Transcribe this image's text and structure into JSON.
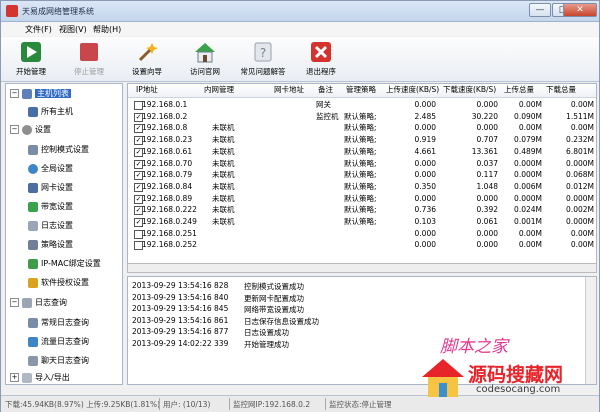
{
  "window": {
    "title": "天易成网络管理系统",
    "min": "—",
    "max": "□",
    "close": "✕"
  },
  "menu": [
    {
      "label": "文件(F)"
    },
    {
      "label": "视图(V)"
    },
    {
      "label": "帮助(H)"
    }
  ],
  "toolbar": [
    {
      "label": "开始管理",
      "icon": "play-icon",
      "color": "#2a8a3c",
      "enabled": true
    },
    {
      "label": "停止管理",
      "icon": "stop-icon",
      "color": "#c9474a",
      "enabled": false
    },
    {
      "label": "设置向导",
      "icon": "wand-icon",
      "color": "#8a5a2b",
      "enabled": true
    },
    {
      "label": "访问官网",
      "icon": "home-icon",
      "color": "#3aa24b",
      "enabled": true
    },
    {
      "label": "常见问题解答",
      "icon": "help-icon",
      "color": "#9aa1ab",
      "enabled": true
    },
    {
      "label": "退出程序",
      "icon": "exit-icon",
      "color": "#d4322c",
      "enabled": true
    }
  ],
  "tree": {
    "root": "主机列表",
    "all_hosts": "所有主机",
    "settings": "设置",
    "settings_items": [
      "控制模式设置",
      "全局设置",
      "网卡设置",
      "带宽设置",
      "日志设置",
      "策略设置",
      "IP-MAC绑定设置",
      "软件授权设置"
    ],
    "logs": "日志查询",
    "log_items": [
      "常规日志查询",
      "流量日志查询",
      "聊天日志查询"
    ],
    "import_export": "导入/导出"
  },
  "table": {
    "headers": [
      "IP地址",
      "内网管理",
      "网卡地址",
      "备注",
      "管理策略",
      "上传速度(KB/S)",
      "下载速度(KB/S)",
      "上传总量",
      "下载总量"
    ],
    "rows": [
      {
        "checked": false,
        "ip": "192.168.0.1",
        "lan": "",
        "mac": "",
        "note": "网关",
        "policy": "",
        "up": "0.000",
        "down": "0.000",
        "uptotal": "0.00M",
        "downtotal": "0.00M"
      },
      {
        "checked": true,
        "ip": "192.168.0.2",
        "lan": "",
        "mac": "",
        "note": "监控机",
        "policy": "默认策略;",
        "up": "2.485",
        "down": "30.220",
        "uptotal": "0.090M",
        "downtotal": "1.511M"
      },
      {
        "checked": true,
        "ip": "192.168.0.8",
        "lan": "未联机",
        "mac": "",
        "note": "",
        "policy": "默认策略;",
        "up": "0.000",
        "down": "0.000",
        "uptotal": "0.00M",
        "downtotal": "0.00M"
      },
      {
        "checked": true,
        "ip": "192.168.0.23",
        "lan": "未联机",
        "mac": "",
        "note": "",
        "policy": "默认策略;",
        "up": "0.919",
        "down": "0.707",
        "uptotal": "0.079M",
        "downtotal": "0.232M"
      },
      {
        "checked": true,
        "ip": "192.168.0.61",
        "lan": "未联机",
        "mac": "",
        "note": "",
        "policy": "默认策略;",
        "up": "4.661",
        "down": "13.361",
        "uptotal": "0.489M",
        "downtotal": "6.801M"
      },
      {
        "checked": true,
        "ip": "192.168.0.70",
        "lan": "未联机",
        "mac": "",
        "note": "",
        "policy": "默认策略;",
        "up": "0.000",
        "down": "0.037",
        "uptotal": "0.000M",
        "downtotal": "0.000M"
      },
      {
        "checked": true,
        "ip": "192.168.0.79",
        "lan": "未联机",
        "mac": "",
        "note": "",
        "policy": "默认策略;",
        "up": "0.000",
        "down": "0.117",
        "uptotal": "0.000M",
        "downtotal": "0.068M"
      },
      {
        "checked": true,
        "ip": "192.168.0.84",
        "lan": "未联机",
        "mac": "",
        "note": "",
        "policy": "默认策略;",
        "up": "0.350",
        "down": "1.048",
        "uptotal": "0.006M",
        "downtotal": "0.012M"
      },
      {
        "checked": true,
        "ip": "192.168.0.89",
        "lan": "未联机",
        "mac": "",
        "note": "",
        "policy": "默认策略;",
        "up": "0.000",
        "down": "0.000",
        "uptotal": "0.000M",
        "downtotal": "0.000M"
      },
      {
        "checked": true,
        "ip": "192.168.0.222",
        "lan": "未联机",
        "mac": "",
        "note": "",
        "policy": "默认策略;",
        "up": "0.736",
        "down": "0.392",
        "uptotal": "0.024M",
        "downtotal": "0.002M"
      },
      {
        "checked": true,
        "ip": "192.168.0.249",
        "lan": "未联机",
        "mac": "",
        "note": "",
        "policy": "默认策略;",
        "up": "0.103",
        "down": "0.061",
        "uptotal": "0.001M",
        "downtotal": "0.000M"
      },
      {
        "checked": false,
        "ip": "192.168.0.251",
        "lan": "",
        "mac": "",
        "note": "",
        "policy": "",
        "up": "0.000",
        "down": "0.000",
        "uptotal": "0.00M",
        "downtotal": "0.00M"
      },
      {
        "checked": false,
        "ip": "192.168.0.252",
        "lan": "",
        "mac": "",
        "note": "",
        "policy": "",
        "up": "0.000",
        "down": "0.000",
        "uptotal": "0.00M",
        "downtotal": "0.00M"
      }
    ]
  },
  "log": [
    {
      "time": "2013-09-29 13:54:16 828",
      "msg": "控制模式设置成功"
    },
    {
      "time": "2013-09-29 13:54:16 840",
      "msg": "更新网卡配置成功"
    },
    {
      "time": "2013-09-29 13:54:16 845",
      "msg": "网络带宽设置成功"
    },
    {
      "time": "2013-09-29 13:54:16 861",
      "msg": "日志保存信息设置成功"
    },
    {
      "time": "2013-09-29 13:54:16 877",
      "msg": "日志设置成功"
    },
    {
      "time": "2013-09-29 14:02:22 339",
      "msg": "开始管理成功"
    }
  ],
  "status": {
    "traffic": "下载:45.94KB(8.97%) 上传:9.25KB(1.81%)",
    "users": "用户: (10/13)",
    "monitor": "监控网IP:192.168.0.2",
    "state": "监控状态:停止管理"
  },
  "watermark": {
    "line1": "脚本之家",
    "line2": "源码搜藏网",
    "line3": "codesocang.com"
  },
  "colors": {
    "selection": "#3169c6",
    "brand_red": "#e8242b",
    "watermark_pink": "#e23a8f"
  }
}
